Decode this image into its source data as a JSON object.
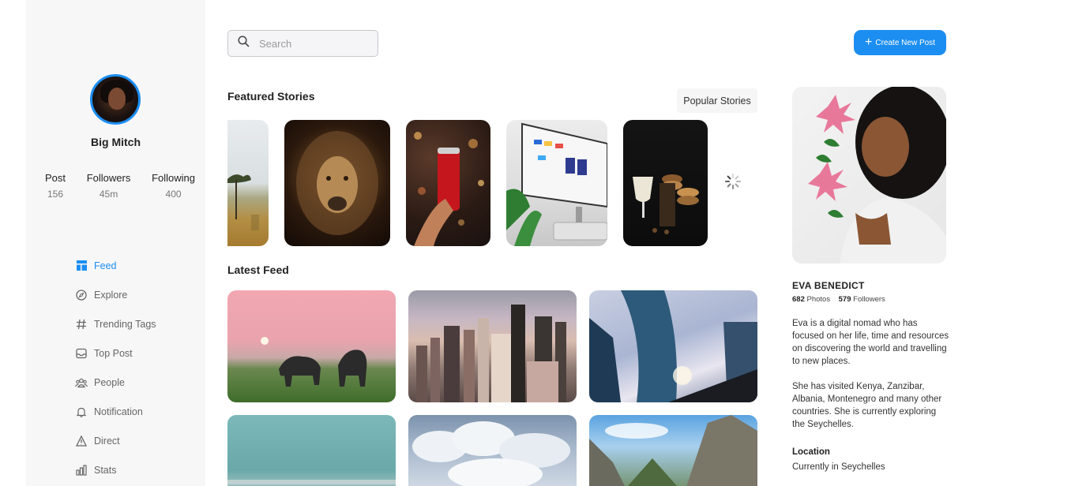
{
  "search": {
    "placeholder": "Search"
  },
  "header": {
    "create_label": "Create New Post"
  },
  "profile": {
    "name": "Big Mitch",
    "stats": [
      {
        "label": "Post",
        "value": "156"
      },
      {
        "label": "Followers",
        "value": "45m"
      },
      {
        "label": "Following",
        "value": "400"
      }
    ]
  },
  "nav": {
    "items": [
      {
        "label": "Feed",
        "icon": "layout-icon"
      },
      {
        "label": "Explore",
        "icon": "compass-icon"
      },
      {
        "label": "Trending Tags",
        "icon": "hash-icon"
      },
      {
        "label": "Top Post",
        "icon": "inbox-icon"
      },
      {
        "label": "People",
        "icon": "people-icon"
      },
      {
        "label": "Notification",
        "icon": "bell-icon"
      },
      {
        "label": "Direct",
        "icon": "send-icon"
      },
      {
        "label": "Stats",
        "icon": "bar-chart-icon"
      }
    ]
  },
  "featured": {
    "title": "Featured Stories",
    "popular_label": "Popular Stories"
  },
  "latest": {
    "title": "Latest Feed"
  },
  "featured_profile": {
    "name": "EVA BENEDICT",
    "photos_count": "682",
    "photos_label": "Photos",
    "followers_count": "579",
    "followers_label": "Followers",
    "bio_1": "Eva is a digital nomad who has focused on her life, time and resources on discovering the world and travelling to new places.",
    "bio_2": "She has visited Kenya, Zanzibar, Albania, Montenegro and many other countries. She is currently exploring the Seychelles.",
    "location_label": "Location",
    "location_value": "Currently in Seychelles"
  },
  "colors": {
    "accent": "#1c8ef2",
    "sidebar_bg": "#f7f7f8"
  }
}
